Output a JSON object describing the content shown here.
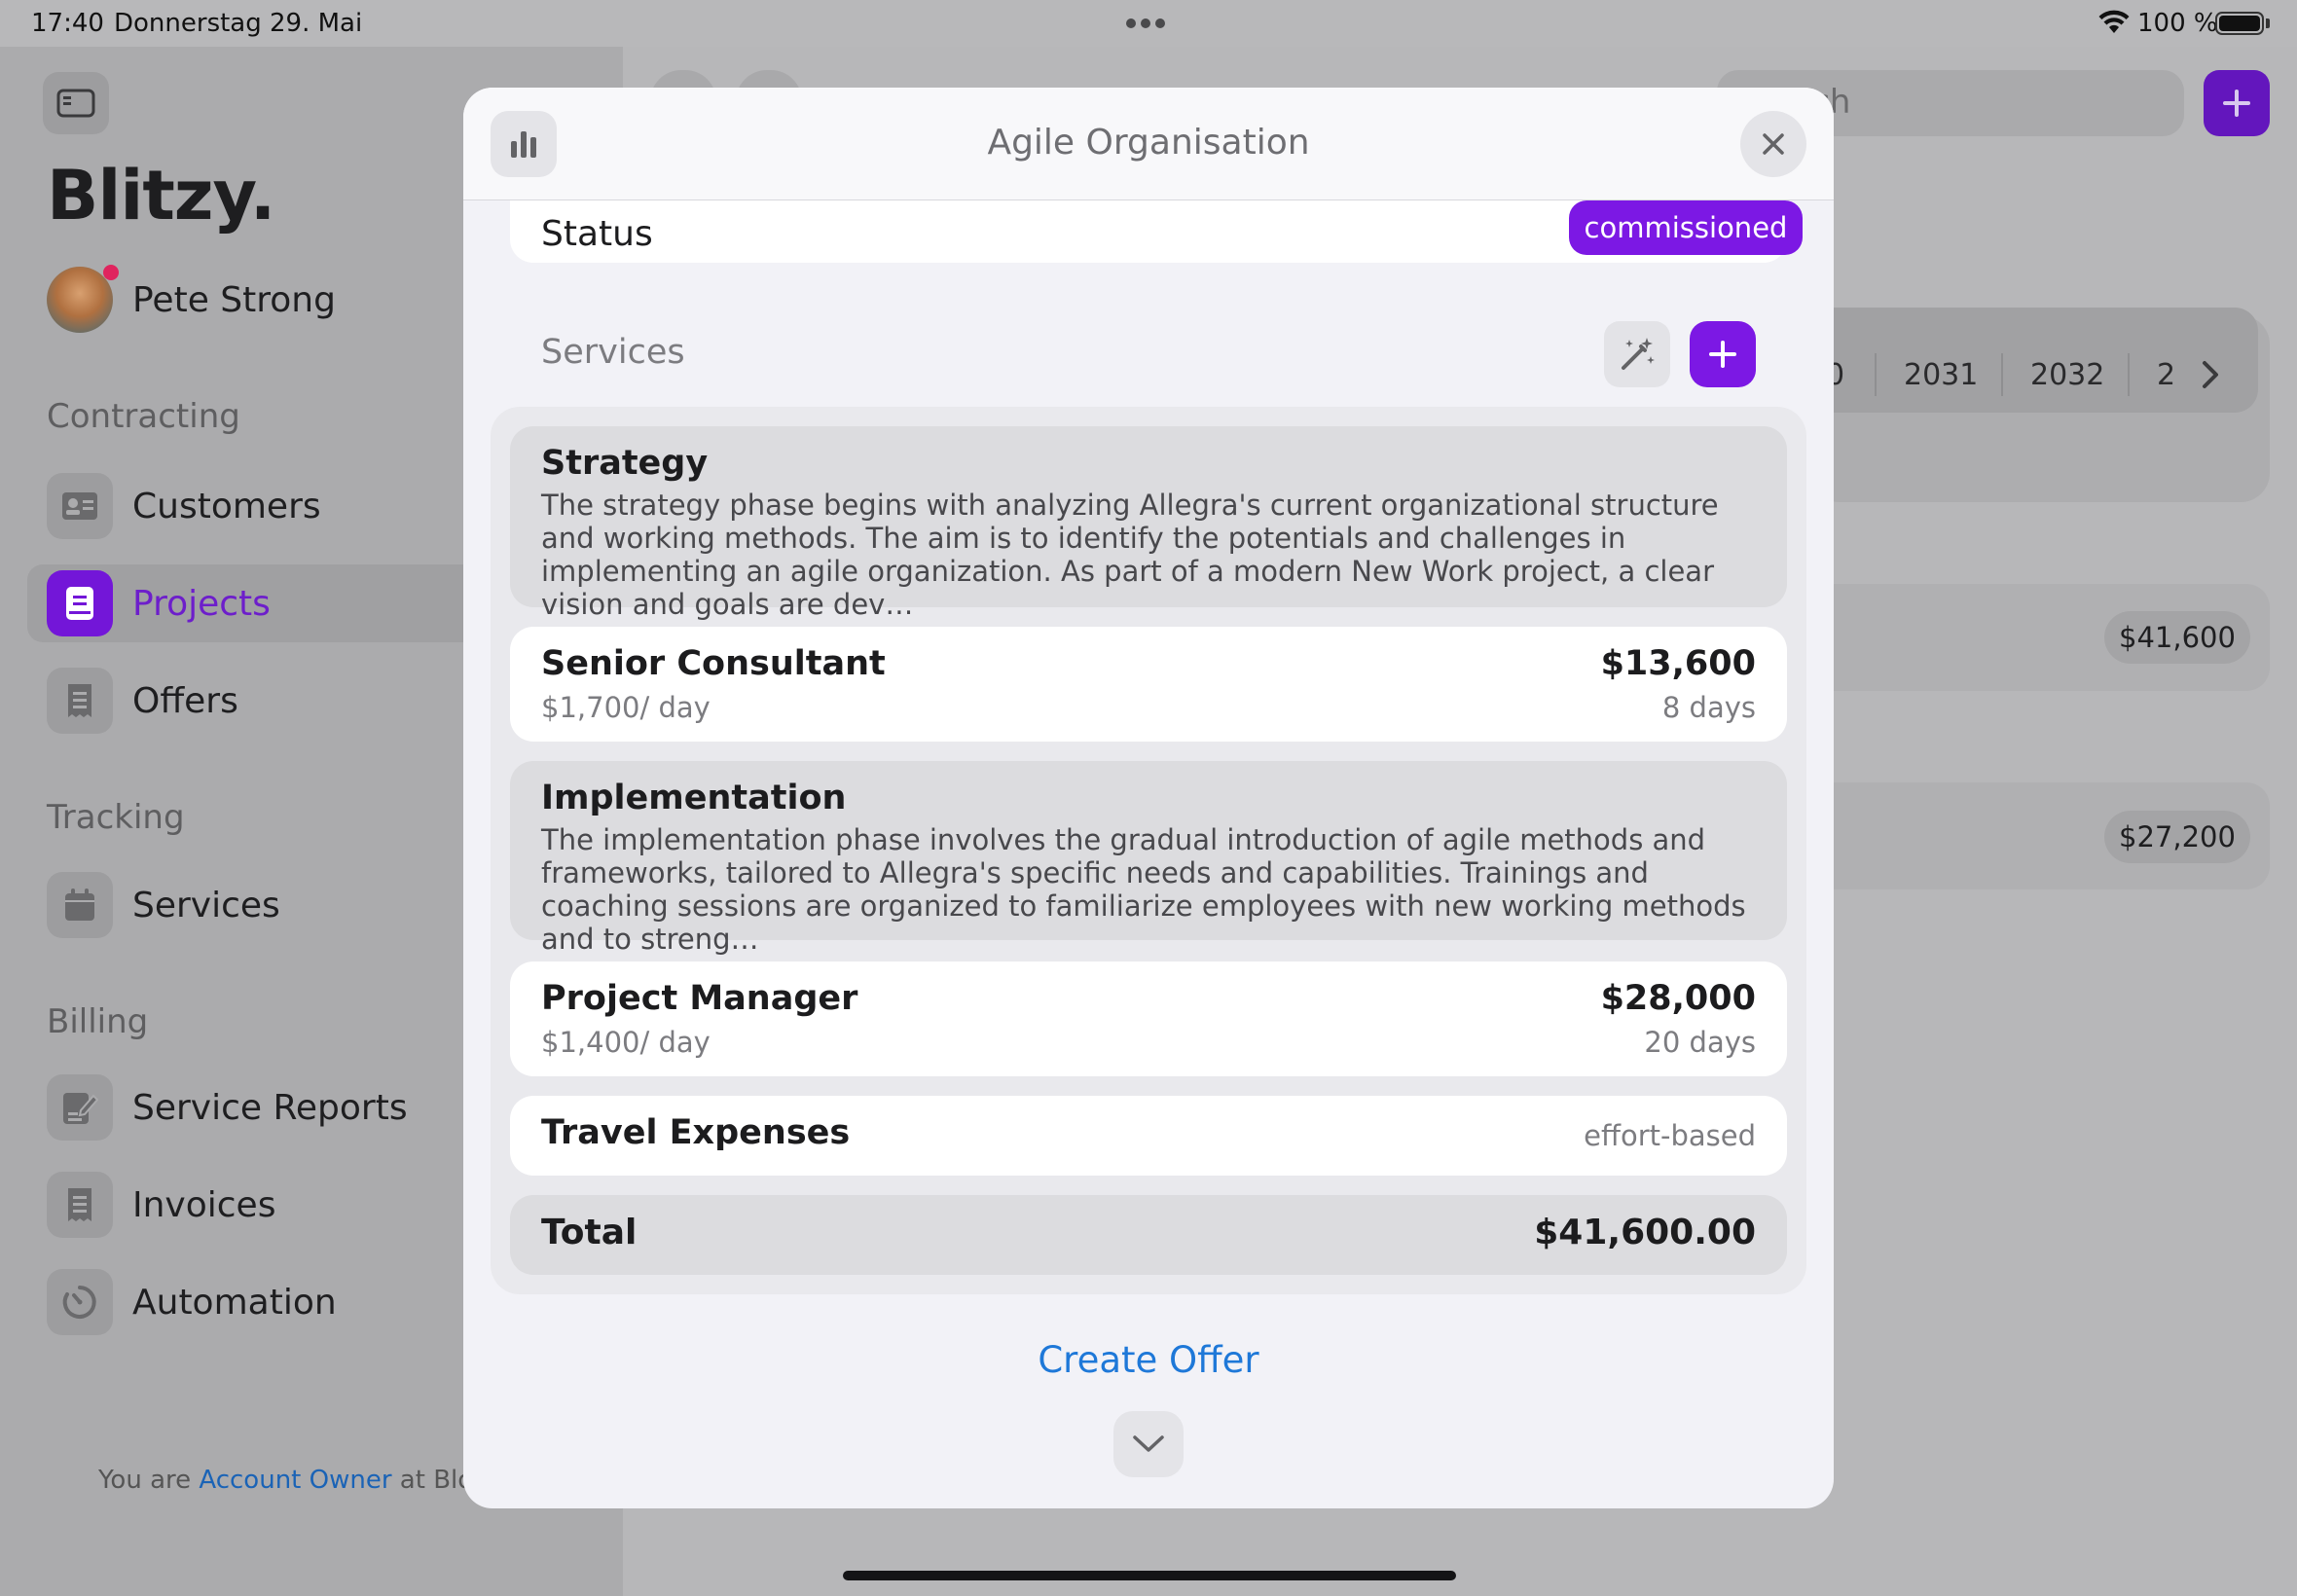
{
  "status_bar": {
    "time": "17:40",
    "date": "Donnerstag 29. Mai",
    "battery": "100 %"
  },
  "sidebar": {
    "logo": "Blitzy.",
    "user_name": "Pete Strong",
    "sections": [
      {
        "title": "Contracting",
        "items": [
          {
            "label": "Customers",
            "icon": "person-card-icon"
          },
          {
            "label": "Projects",
            "icon": "book-icon",
            "active": true
          },
          {
            "label": "Offers",
            "icon": "receipt-icon"
          }
        ]
      },
      {
        "title": "Tracking",
        "items": [
          {
            "label": "Services",
            "icon": "calendar-icon"
          }
        ]
      },
      {
        "title": "Billing",
        "items": [
          {
            "label": "Service Reports",
            "icon": "document-edit-icon"
          },
          {
            "label": "Invoices",
            "icon": "invoice-icon"
          },
          {
            "label": "Automation",
            "icon": "timer-icon"
          }
        ]
      }
    ],
    "footer": {
      "prefix": "You are ",
      "role": "Account Owner",
      "suffix": " at Bloom LLC"
    }
  },
  "background": {
    "search_placeholder": "rch",
    "years": [
      "0",
      "2031",
      "2032",
      "2"
    ],
    "amounts": [
      "$41,600",
      "$27,200"
    ]
  },
  "modal": {
    "title": "Agile Organisation",
    "status_label": "Status",
    "status_value": "commissioned",
    "services_label": "Services",
    "phases": [
      {
        "title": "Strategy",
        "description": "The strategy phase begins with analyzing Allegra's current organizational structure and working methods. The aim is to identify the potentials and challenges in implementing an agile organization. As part of a modern New Work project, a clear vision and goals are dev…"
      },
      {
        "title": "Implementation",
        "description": "The implementation phase involves the gradual introduction of agile methods and frameworks, tailored to Allegra's specific needs and capabilities. Trainings and coaching sessions are organized to familiarize employees with new working methods and to streng…"
      }
    ],
    "lines": [
      {
        "name": "Senior Consultant",
        "rate": "$1,700/ day",
        "amount": "$13,600",
        "days": "8 days"
      },
      {
        "name": "Project Manager",
        "rate": "$1,400/ day",
        "amount": "$28,000",
        "days": "20 days"
      }
    ],
    "travel": {
      "name": "Travel Expenses",
      "note": "effort-based"
    },
    "total": {
      "label": "Total",
      "value": "$41,600.00"
    },
    "create_offer": "Create Offer"
  },
  "colors": {
    "accent": "#7c18e4",
    "link": "#1e78d8"
  }
}
